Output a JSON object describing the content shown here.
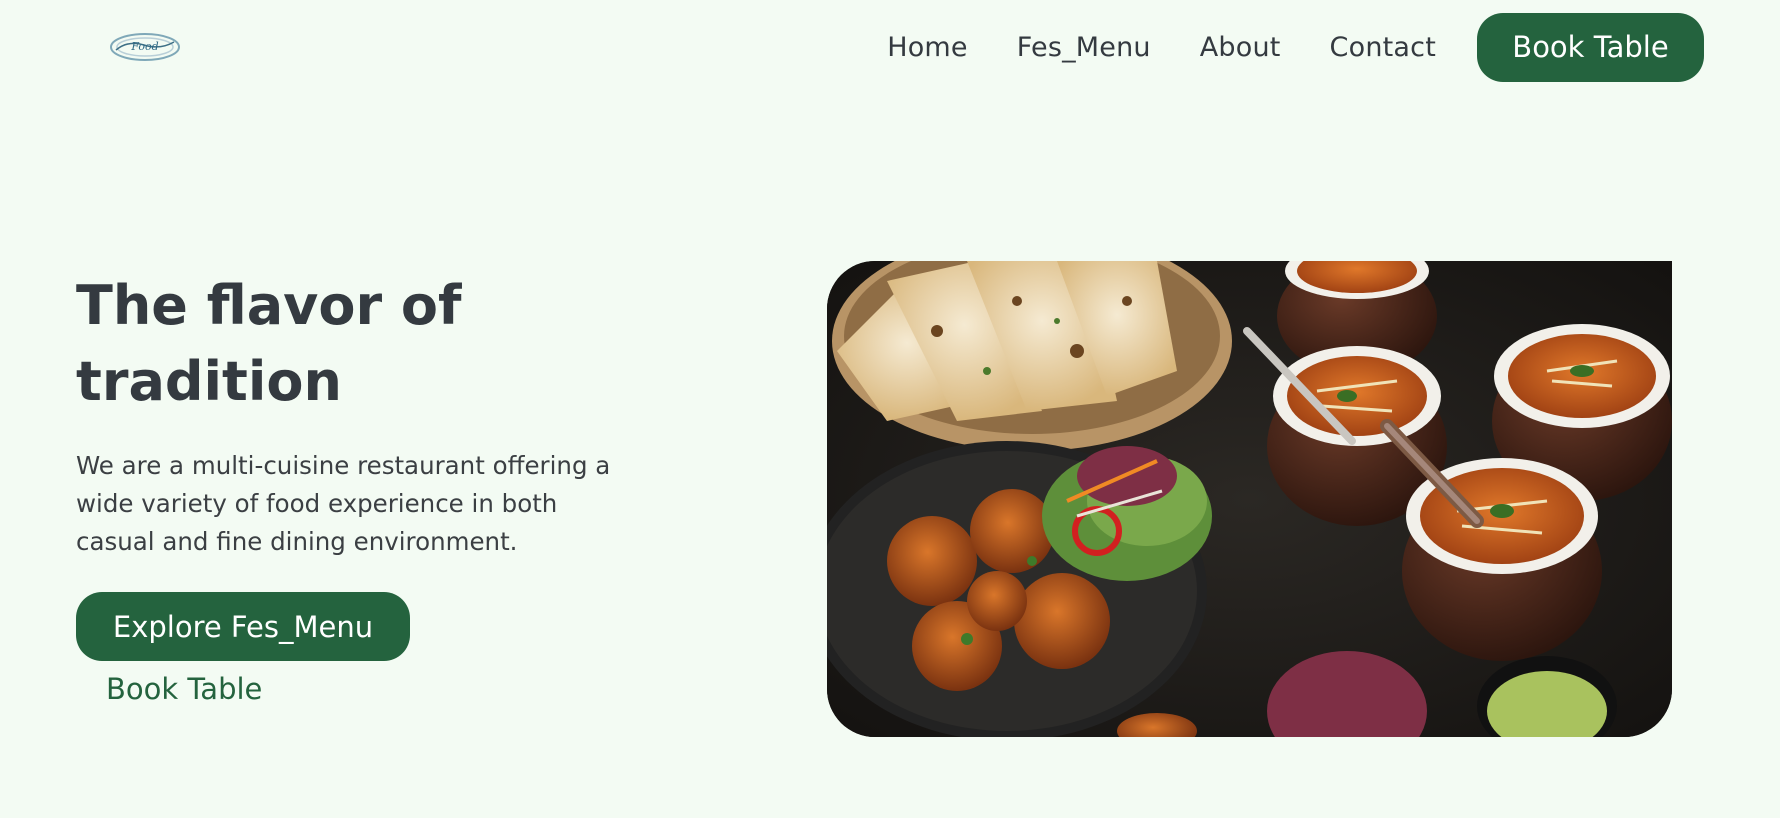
{
  "header": {
    "logo_text": "Food",
    "nav": {
      "home": "Home",
      "menu": "Fes_Menu",
      "about": "About",
      "contact": "Contact",
      "book": "Book Table"
    }
  },
  "hero": {
    "title": "The flavor of tradition",
    "description": "We are a multi-cuisine restaurant offering a wide variety of food experience in both casual and fine dining environment.",
    "explore_button": "Explore Fes_Menu",
    "book_link": "Book Table"
  },
  "colors": {
    "background": "#f3fbf3",
    "accent": "#24633e",
    "text": "#343a40"
  }
}
